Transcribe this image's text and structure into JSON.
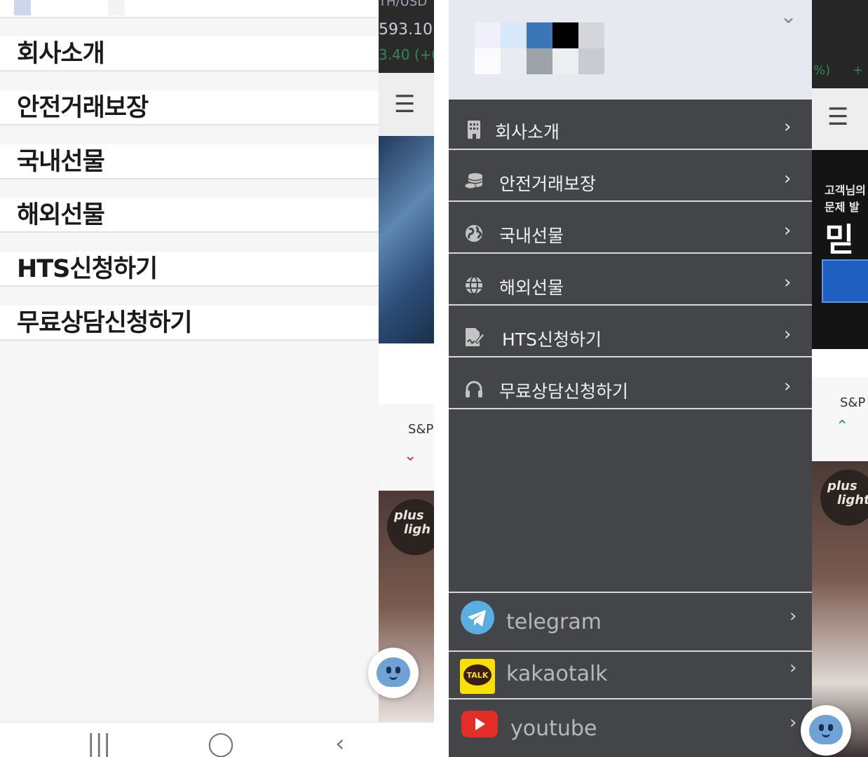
{
  "left_screen": {
    "background": {
      "ticker_line1": "TH/USD",
      "ticker_price": "593.10",
      "ticker_change": "3.40 (+0",
      "index_label": "S&P",
      "index_arrow": "⌄",
      "video_logo_line1": "plus",
      "video_logo_line2": "ligh"
    },
    "menu_items": [
      {
        "label": "회사소개"
      },
      {
        "label": "안전거래보장"
      },
      {
        "label": "국내선물"
      },
      {
        "label": "해외선물"
      },
      {
        "label": "HTS신청하기"
      },
      {
        "label": "무료상담신청하기"
      }
    ],
    "navbar": {
      "recent_icon": "|||",
      "home_icon": "◯",
      "back_icon": "‹"
    }
  },
  "right_screen": {
    "header": {
      "collapse_icon": "chevron-down-icon"
    },
    "background": {
      "ticker_change": "%)",
      "ticker_plus": "+",
      "banner_line1": "고객님의",
      "banner_line2": "문제 발",
      "banner_line3": "믿",
      "index_label": "S&P",
      "index_arrow": "⌃",
      "video_logo_line1": "plus",
      "video_logo_line2": "light"
    },
    "menu_items": [
      {
        "label": "회사소개",
        "icon": "building-icon"
      },
      {
        "label": "안전거래보장",
        "icon": "coins-icon"
      },
      {
        "label": "국내선물",
        "icon": "globe-icon"
      },
      {
        "label": "해외선물",
        "icon": "globe-grid-icon"
      },
      {
        "label": "HTS신청하기",
        "icon": "signature-icon"
      },
      {
        "label": "무료상담신청하기",
        "icon": "headphones-icon"
      }
    ],
    "social_links": [
      {
        "label": "telegram",
        "icon": "telegram-icon",
        "color": "#5aaee0"
      },
      {
        "label": "kakaotalk",
        "icon": "kakaotalk-icon",
        "color": "#f9e000",
        "badge": "TALK"
      },
      {
        "label": "youtube",
        "icon": "youtube-icon",
        "color": "#e52d27"
      }
    ]
  },
  "colors": {
    "left_menu_bg": "#f6f6f6",
    "right_menu_bg": "#444548",
    "right_header_bg": "#e6e9f0",
    "chatbot_face": "#6fa2d6"
  }
}
